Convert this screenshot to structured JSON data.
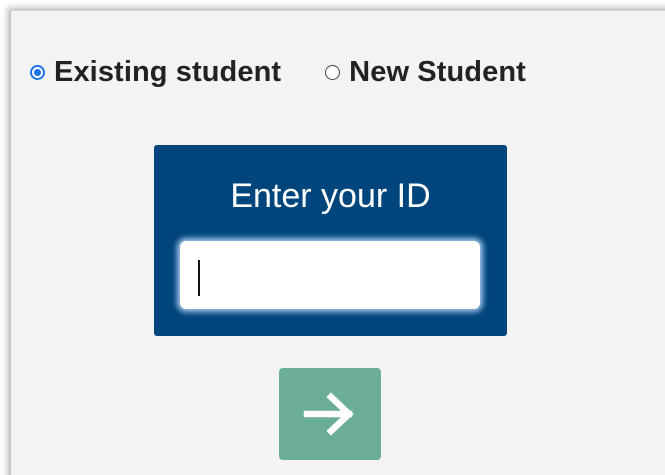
{
  "login": {
    "options": [
      {
        "label": "Existing student",
        "selected": true
      },
      {
        "label": "New Student",
        "selected": false
      }
    ],
    "id_prompt": "Enter your ID",
    "id_value": "",
    "next_icon": "arrow-right-icon"
  },
  "colors": {
    "card_background": "#00457c",
    "button_background": "#6aae98",
    "radio_accent": "#1a73e8",
    "panel_background": "#f3f3f3"
  }
}
